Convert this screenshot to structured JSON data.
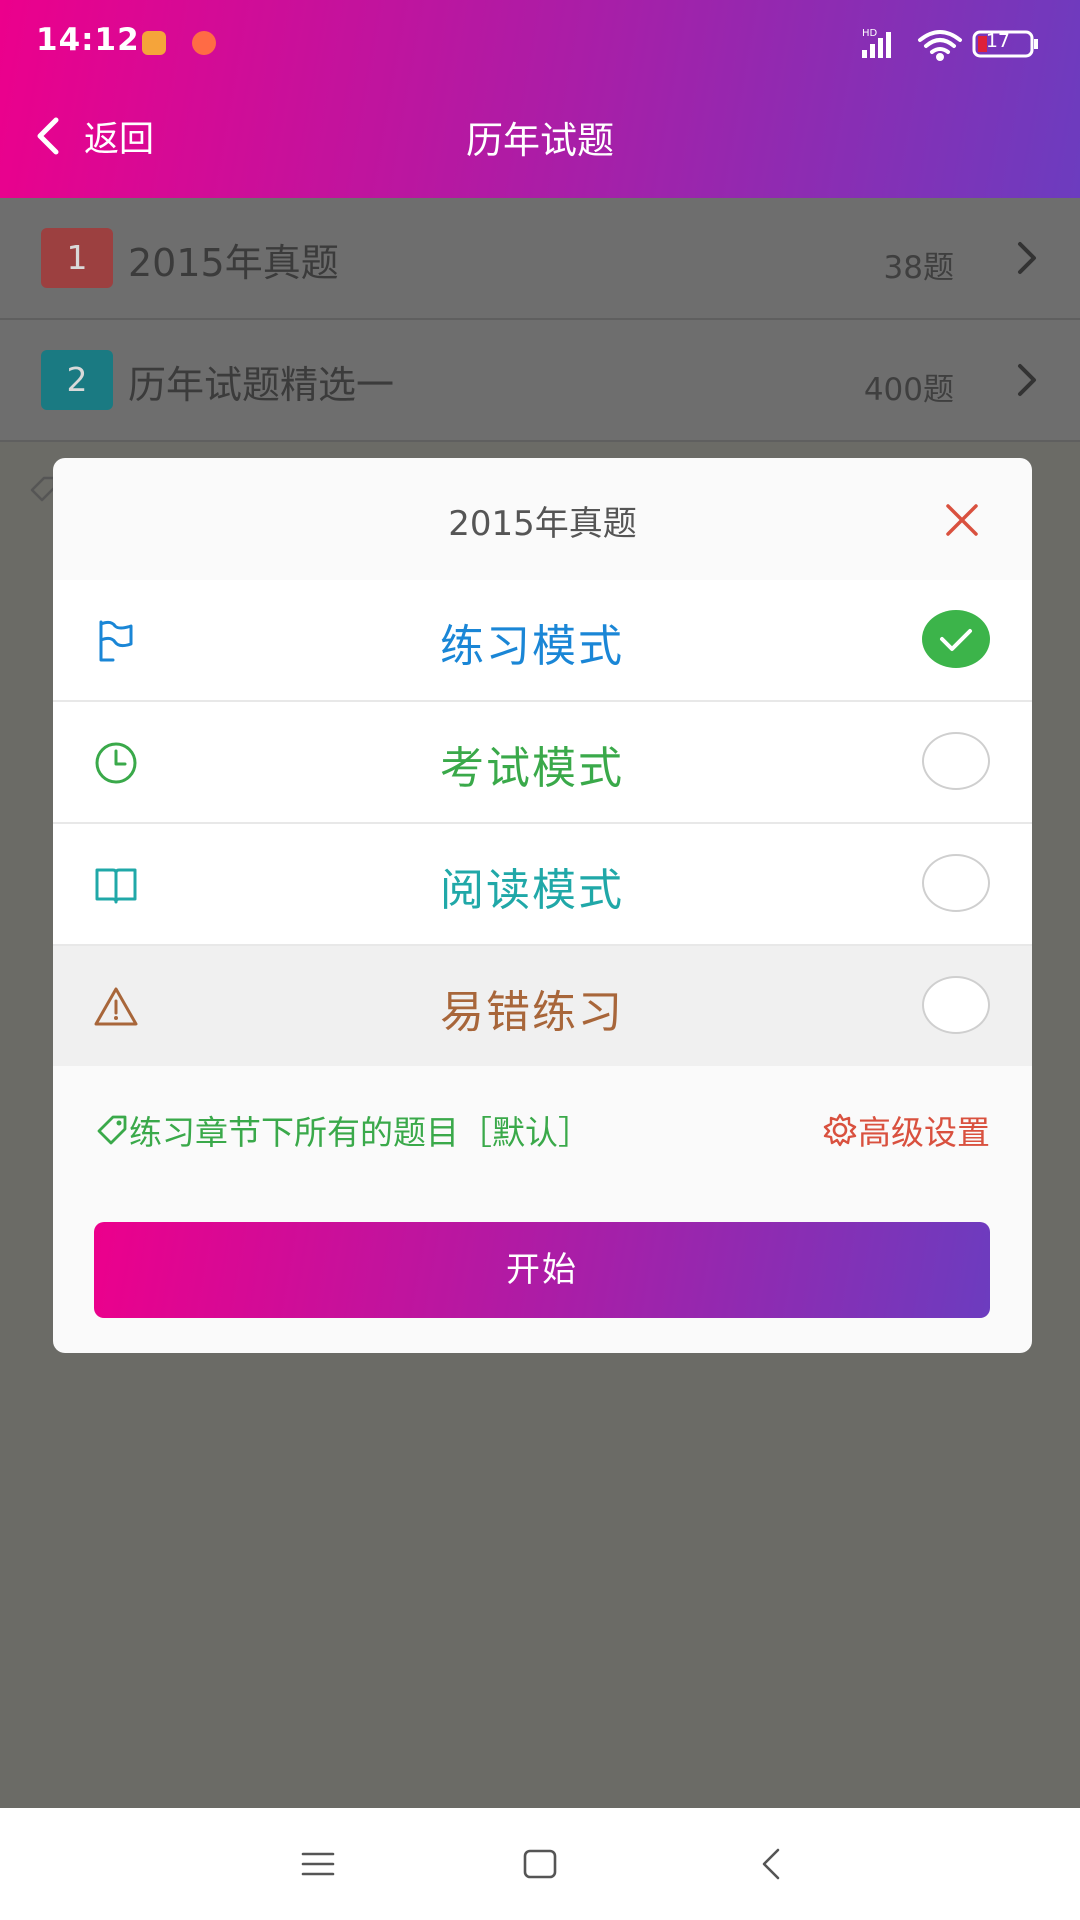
{
  "status_bar": {
    "time": "14:12",
    "battery": "17"
  },
  "header": {
    "back_label": "返回",
    "title": "历年试题"
  },
  "list": {
    "items": [
      {
        "index": "1",
        "title": "2015年真题",
        "count": "38题",
        "badge_color": "#b84444"
      },
      {
        "index": "2",
        "title": "历年试题精选一",
        "count": "400题",
        "badge_color": "#1a8f9a"
      }
    ]
  },
  "dialog": {
    "title": "2015年真题",
    "modes": [
      {
        "label": "练习模式",
        "color": "#1a86d6",
        "icon": "flag-icon",
        "checked": true
      },
      {
        "label": "考试模式",
        "color": "#3aa94a",
        "icon": "clock-icon",
        "checked": false
      },
      {
        "label": "阅读模式",
        "color": "#20a8a8",
        "icon": "book-icon",
        "checked": false
      },
      {
        "label": "易错练习",
        "color": "#a8663a",
        "icon": "warning-icon",
        "checked": false
      }
    ],
    "hint": "练习章节下所有的题目［默认］",
    "advanced_settings": "高级设置",
    "start_button": "开始"
  },
  "colors": {
    "accent_start": "#ec008c",
    "accent_end": "#6c3cbf",
    "check_green": "#3cb44a",
    "close_red": "#d9513f"
  }
}
